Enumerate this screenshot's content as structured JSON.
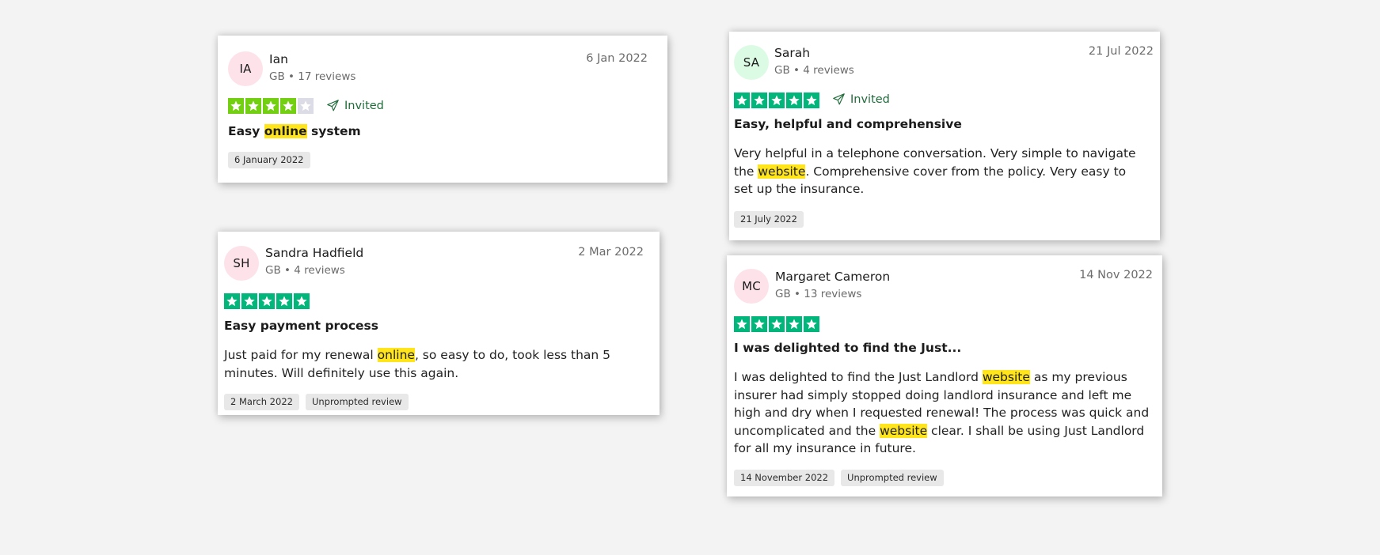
{
  "colors": {
    "star_green": "#00b67a",
    "star_light_green": "#73cf11",
    "star_empty": "#dcdce6",
    "highlight": "#ffe51a",
    "invited_green": "#1f6b3a"
  },
  "reviews": [
    {
      "initials": "IA",
      "avatar_bg": "#fde2ea",
      "name": "Ian",
      "meta": "GB • 17 reviews",
      "date": "6 Jan 2022",
      "rating": 4,
      "invited_label": "Invited",
      "title_pre": "Easy ",
      "title_hl": "online",
      "title_post": " system",
      "chips": [
        "6 January 2022"
      ]
    },
    {
      "initials": "SA",
      "avatar_bg": "#dcfbe4",
      "name": "Sarah",
      "meta": "GB • 4 reviews",
      "date": "21 Jul 2022",
      "rating": 5,
      "invited_label": "Invited",
      "title": "Easy, helpful and comprehensive",
      "body": [
        {
          "t": "Very helpful in a telephone conversation. Very simple to navigate the "
        },
        {
          "t": "website",
          "hl": true
        },
        {
          "t": ". Comprehensive cover from the policy. Very easy to set up the insurance."
        }
      ],
      "chips": [
        "21 July 2022"
      ]
    },
    {
      "initials": "SH",
      "avatar_bg": "#fde2ea",
      "name": "Sandra Hadfield",
      "meta": "GB • 4 reviews",
      "date": "2 Mar 2022",
      "rating": 5,
      "title": "Easy payment process",
      "body": [
        {
          "t": "Just paid for my renewal "
        },
        {
          "t": "online",
          "hl": true
        },
        {
          "t": ", so easy to do, took less than 5 minutes. Will definitely use this again."
        }
      ],
      "chips": [
        "2 March 2022",
        "Unprompted review"
      ]
    },
    {
      "initials": "MC",
      "avatar_bg": "#fde2ea",
      "name": "Margaret Cameron",
      "meta": "GB • 13 reviews",
      "date": "14 Nov 2022",
      "rating": 5,
      "title": "I was delighted to find the Just...",
      "body": [
        {
          "t": "I was delighted to find the Just Landlord "
        },
        {
          "t": "website",
          "hl": true
        },
        {
          "t": " as my previous insurer had simply stopped doing landlord insurance and left me high and dry when I requested renewal! The process was quick and uncomplicated and the "
        },
        {
          "t": "website",
          "hl": true
        },
        {
          "t": " clear. I shall be using Just Landlord for all my insurance in future."
        }
      ],
      "chips": [
        "14 November 2022",
        "Unprompted review"
      ]
    }
  ]
}
